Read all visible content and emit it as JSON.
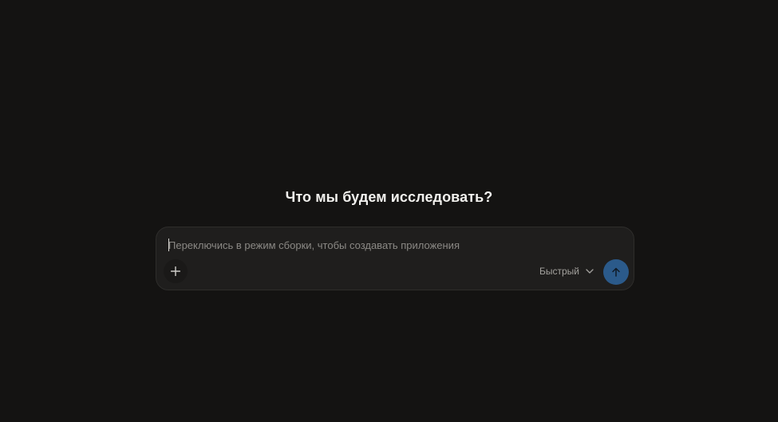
{
  "main": {
    "heading": "Что мы будем исследовать?"
  },
  "composer": {
    "value": "",
    "placeholder": "Переключись в режим сборки, чтобы создавать приложения",
    "model_label": "Быстрый",
    "icons": {
      "add": "plus-icon",
      "model_dropdown": "chevron-down-icon",
      "send": "arrow-up-icon"
    }
  },
  "colors": {
    "background": "#141312",
    "composer_bg": "#1f1e1d",
    "send_button": "#2b5a8a",
    "heading_text": "#f2f1ee",
    "placeholder_text": "#8b8985"
  }
}
